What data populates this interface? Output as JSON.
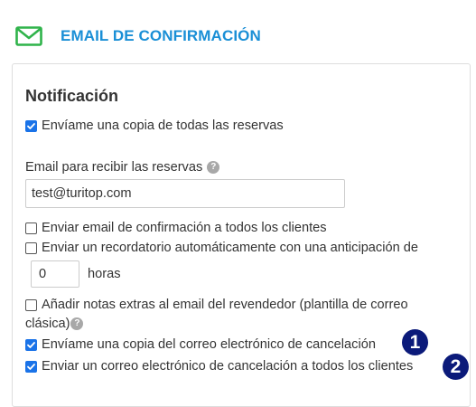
{
  "header": {
    "icon": "envelope-icon",
    "title": "EMAIL DE CONFIRMACIÓN",
    "accent_color": "#1a8fd6",
    "icon_color": "#2fb34a"
  },
  "notification": {
    "section_title": "Notificación",
    "send_copy_all_bookings": {
      "label": "Envíame una copia de todas las reservas",
      "checked": true
    },
    "email_field": {
      "label": "Email para recibir las reservas",
      "value": "test@turitop.com"
    },
    "send_confirmation_all_clients": {
      "label": "Enviar email de confirmación a todos los clientes",
      "checked": false
    },
    "auto_reminder": {
      "label": "Enviar un recordatorio automáticamente con una anticipación de",
      "checked": false,
      "hours_value": "0",
      "hours_label": "horas"
    },
    "reseller_notes": {
      "label_line1": "Añadir notas extras al email del revendedor (plantilla de correo",
      "label_line2": "clásica)",
      "checked": false
    },
    "send_copy_cancellation": {
      "label": "Envíame una copia del correo electrónico de cancelación",
      "checked": true,
      "badge": "1"
    },
    "send_cancellation_all_clients": {
      "label": "Enviar un correo electrónico de cancelación a todos los clientes",
      "checked": true,
      "badge": "2"
    }
  },
  "colors": {
    "checkbox_checked": "#1a73e8",
    "badge": "#0b1a7a"
  }
}
